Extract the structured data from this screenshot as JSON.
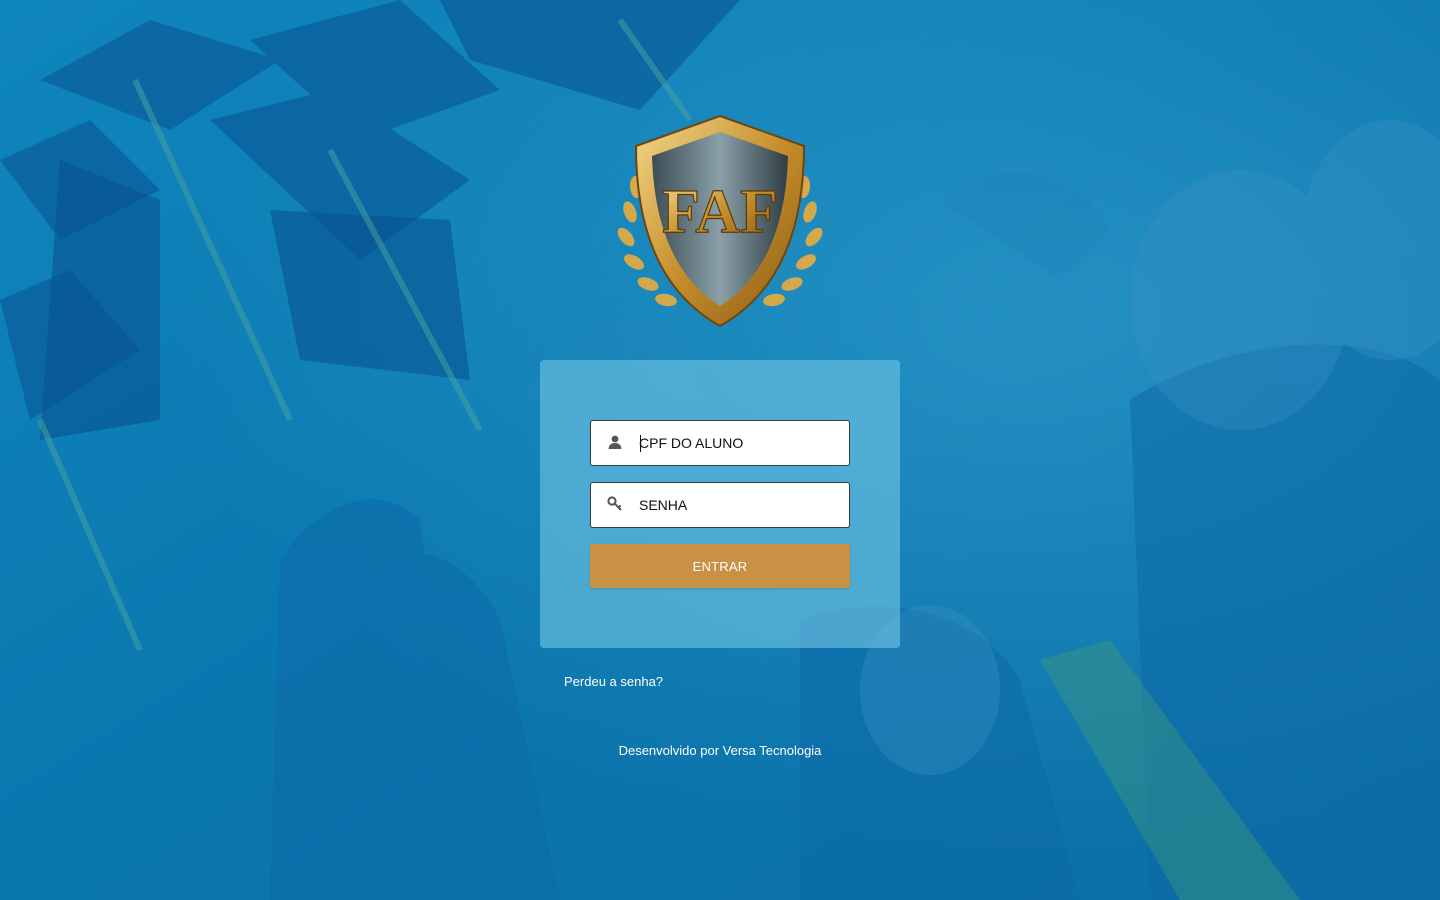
{
  "logo": {
    "text": "FAF"
  },
  "login": {
    "cpf_placeholder": "CPF DO ALUNO",
    "cpf_icon": "user-icon",
    "password_placeholder": "SENHA",
    "password_icon": "key-icon",
    "submit_label": "ENTRAR"
  },
  "links": {
    "lost_password": "Perdeu a senha?"
  },
  "footer": {
    "credit": "Desenvolvido por Versa Tecnologia"
  },
  "colors": {
    "background": "#0d7fb4",
    "button": "#c99143",
    "card": "#70c4e4",
    "logo_gold": "#d4a84b"
  }
}
